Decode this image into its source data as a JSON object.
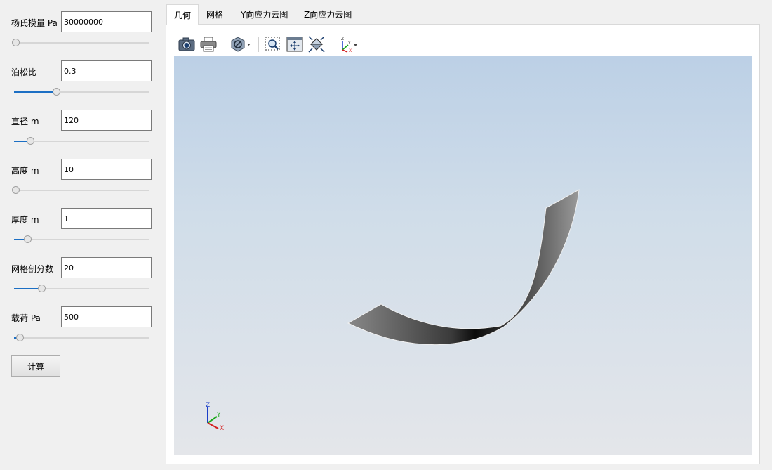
{
  "params": [
    {
      "key": "youngs_modulus",
      "label": "杨氏模量 Pa",
      "value": "30000000",
      "slider_fraction": 0.0
    },
    {
      "key": "poisson_ratio",
      "label": "泊松比",
      "value": "0.3",
      "slider_fraction": 0.3
    },
    {
      "key": "diameter",
      "label": "直径 m",
      "value": "120",
      "slider_fraction": 0.11
    },
    {
      "key": "height",
      "label": "高度 m",
      "value": "10",
      "slider_fraction": 0.0
    },
    {
      "key": "thickness",
      "label": "厚度 m",
      "value": "1",
      "slider_fraction": 0.09
    },
    {
      "key": "mesh_divisions",
      "label": "网格剖分数",
      "value": "20",
      "slider_fraction": 0.19
    },
    {
      "key": "load",
      "label": "载荷 Pa",
      "value": "500",
      "slider_fraction": 0.03
    }
  ],
  "calc_button_label": "计算",
  "tabs": [
    {
      "label": "几何",
      "active": true
    },
    {
      "label": "网格",
      "active": false
    },
    {
      "label": "Y向应力云图",
      "active": false
    },
    {
      "label": "Z向应力云图",
      "active": false
    }
  ],
  "toolbar_icons": [
    "camera-icon",
    "print-icon",
    "display-mode-icon",
    "zoom-box-icon",
    "fit-all-icon",
    "pan-icon",
    "view-orientation-icon"
  ],
  "axes": {
    "x": "X",
    "y": "Y",
    "z": "Z"
  },
  "colors": {
    "accent": "#1c6fc4",
    "viewport_top": "#bcd0e6",
    "viewport_bottom": "#e4e6ea"
  }
}
